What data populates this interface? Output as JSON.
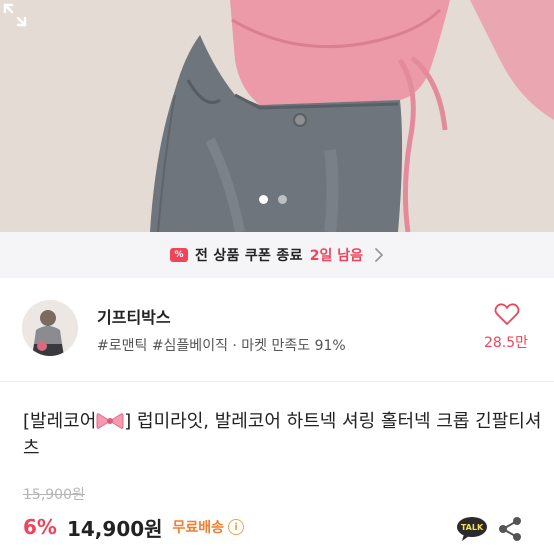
{
  "hero": {
    "image_alt": "model wearing pink top and grey jeans",
    "slide_count": 2,
    "active_slide": 1,
    "expand_icon": "expand-icon"
  },
  "coupon": {
    "icon_label": "%",
    "text": "전 상품 쿠폰 종료",
    "days_left": "2일 남음"
  },
  "shop": {
    "name": "기프티박스",
    "tags": "#로맨틱 #심플베이직 · 마켓 만족도 91%",
    "like_count": "28.5만"
  },
  "product": {
    "title_prefix": "[발레코어",
    "title_rest": "] 럽미라잇, 발레코어 하트넥 셔링 홀터넥 크롭 긴팔티셔츠",
    "original_price": "15,900원",
    "discount": "6%",
    "price": "14,900원",
    "shipping": "무료배송",
    "info_symbol": "i",
    "talk_label": "TALK"
  },
  "colors": {
    "accent": "#f1445b",
    "shipping": "#f57c2f",
    "talk_bg": "#2a2a2a",
    "talk_text": "#f7e04b"
  }
}
